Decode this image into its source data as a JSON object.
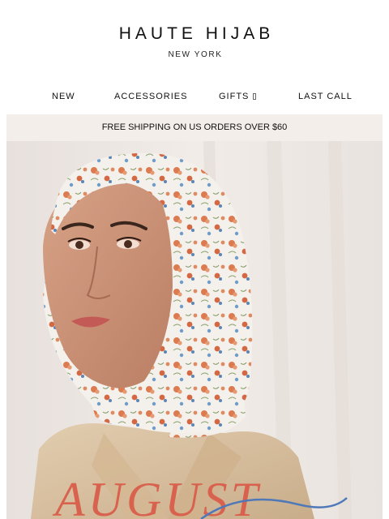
{
  "brand": {
    "name": "HAUTE HIJAB",
    "location": "NEW YORK"
  },
  "nav": {
    "items": [
      {
        "label": "NEW"
      },
      {
        "label": "ACCESSORIES"
      },
      {
        "label": "GIFTS"
      },
      {
        "label": "LAST CALL"
      }
    ]
  },
  "banner": {
    "text": "FREE SHIPPING ON US ORDERS OVER $60"
  },
  "hero": {
    "headline": "AUGUST",
    "colors": {
      "background": "#ece6e2",
      "scarf": "#f3efea",
      "floral": "#d9734a",
      "floral_blue": "#5b86b4",
      "skin": "#c99276",
      "shirt": "#d9c1a0",
      "headline": "#d9624e"
    }
  }
}
